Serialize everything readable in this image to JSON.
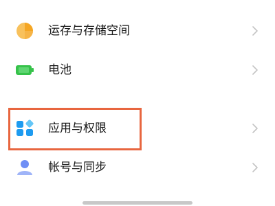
{
  "settings": {
    "items": [
      {
        "label": "运存与存储空间",
        "icon": "storage-pie-icon",
        "icon_color": "#f5a623"
      },
      {
        "label": "电池",
        "icon": "battery-icon",
        "icon_color": "#36c24a"
      },
      {
        "label": "应用与权限",
        "icon": "apps-grid-icon",
        "icon_color": "#1e9bf0"
      },
      {
        "label": "帐号与同步",
        "icon": "account-person-icon",
        "icon_color": "#6e8ef5"
      }
    ]
  },
  "colors": {
    "highlight": "#e8663f",
    "chevron": "#c4c4c4"
  }
}
